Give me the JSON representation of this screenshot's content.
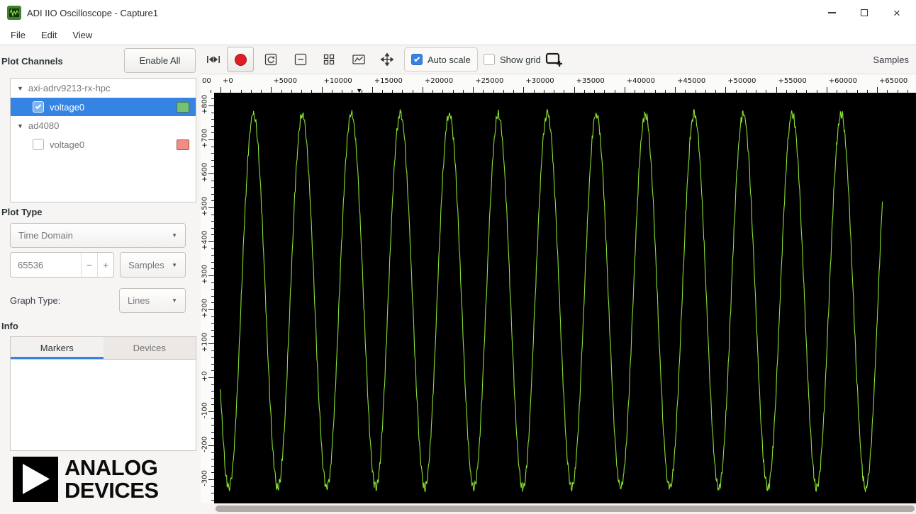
{
  "window": {
    "title": "ADI IIO Oscilloscope - Capture1"
  },
  "menu": {
    "items": [
      "File",
      "Edit",
      "View"
    ]
  },
  "sidebar": {
    "plot_channels_label": "Plot Channels",
    "enable_all_label": "Enable All",
    "devices": [
      {
        "name": "axi-adrv9213-rx-hpc",
        "channel_label": "voltage0",
        "channel_color": "#74c274",
        "checked": true,
        "selected": true
      },
      {
        "name": "ad4080",
        "channel_label": "voltage0",
        "channel_color": "#f28b82",
        "checked": false,
        "selected": false
      }
    ],
    "plot_type_label": "Plot Type",
    "plot_type_value": "Time Domain",
    "sample_count": "65536",
    "decrement_label": "−",
    "increment_label": "+",
    "units_value": "Samples",
    "graph_type_label": "Graph Type:",
    "graph_type_value": "Lines",
    "info_label": "Info",
    "tabs": [
      "Markers",
      "Devices"
    ],
    "logo": {
      "line1": "ANALOG",
      "line2": "DEVICES"
    }
  },
  "toolbar": {
    "auto_scale_label": "Auto scale",
    "auto_scale_checked": true,
    "show_grid_label": "Show grid",
    "show_grid_checked": false,
    "samples_label": "Samples"
  },
  "icons": {
    "chevron_down": "▼",
    "expander": "▼",
    "marker": "▼",
    "close": "×"
  },
  "colors": {
    "accent": "#3584e4",
    "selection": "#3584e4",
    "trace": "#8ae234",
    "record": "#e01b24",
    "plot_background": "#000000"
  },
  "chart_data": {
    "type": "line",
    "title": "",
    "background": "#000000",
    "grid": false,
    "x_axis": {
      "label": "Samples",
      "ticks": [
        "00",
        "+0",
        "+5000",
        "+10000",
        "+15000",
        "+20000",
        "+25000",
        "+30000",
        "+35000",
        "+40000",
        "+45000",
        "+50000",
        "+55000",
        "+60000",
        "+65000"
      ],
      "range": [
        0,
        65536
      ],
      "minor_step": 1000,
      "marker_position": 13700
    },
    "y_axis": {
      "ticks": [
        "+800",
        "+700",
        "+600",
        "+500",
        "+400",
        "+300",
        "+200",
        "+100",
        "+0",
        "-100",
        "-200",
        "-300"
      ],
      "range": [
        -370,
        837
      ],
      "minor_step": 20
    },
    "series": [
      {
        "name": "voltage0",
        "color": "#8ae234",
        "shape": "sine",
        "samples": 65536,
        "period_samples": 4850,
        "cycles": 13.5,
        "amplitude": 550,
        "offset": 225,
        "phase_rad": -2.65,
        "noise": 14
      }
    ]
  }
}
